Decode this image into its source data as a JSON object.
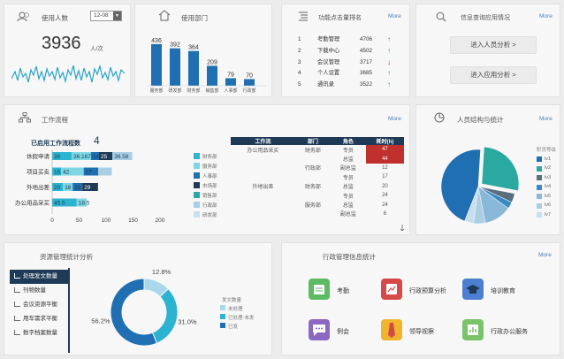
{
  "users": {
    "title": "使用人数",
    "date": "12-08",
    "count": "3936",
    "unit": "人/次"
  },
  "dept": {
    "title": "使用部门",
    "chart_data": {
      "type": "bar",
      "categories": [
        "服务部",
        "研发部",
        "财务部",
        "销售部",
        "人事部",
        "行政部"
      ],
      "values": [
        436,
        392,
        364,
        209,
        79,
        70
      ]
    }
  },
  "rank": {
    "title": "功能点击量排名",
    "more": "More",
    "rows": [
      {
        "no": "1",
        "name": "考勤管理",
        "val": "4706",
        "trend": "up"
      },
      {
        "no": "2",
        "name": "下载中心",
        "val": "4502",
        "trend": "up"
      },
      {
        "no": "3",
        "name": "会议管理",
        "val": "3717",
        "trend": "down"
      },
      {
        "no": "4",
        "name": "个人设置",
        "val": "3685",
        "trend": "up"
      },
      {
        "no": "5",
        "name": "通讯录",
        "val": "3522",
        "trend": "up"
      }
    ]
  },
  "query": {
    "title": "信息查询应用情况",
    "more": "More",
    "btn1": "进入人员分析 >",
    "btn2": "进入应用分析 >"
  },
  "workflow": {
    "title": "工作流程",
    "more": "More",
    "count_label": "已启用工作流程数",
    "count": "4",
    "chart_data": {
      "type": "bar",
      "categories": [
        "休假申请",
        "项目买卖",
        "外地出差",
        "办公用品采买"
      ],
      "series": [
        {
          "name": "财务部",
          "values": [
            36,
            16.5,
            20,
            45.5
          ]
        },
        {
          "name": "服务部",
          "values": [
            36.167,
            42,
            18,
            18.5
          ]
        },
        {
          "name": "人事部",
          "values": [
            14.667,
            27,
            18,
            0
          ]
        },
        {
          "name": "市场部",
          "values": [
            25,
            0,
            29,
            0
          ]
        },
        {
          "name": "销售部",
          "values": [
            0,
            0,
            0,
            0
          ]
        },
        {
          "name": "行政部",
          "values": [
            36.58,
            25,
            0,
            0
          ]
        },
        {
          "name": "研发部",
          "values": [
            0,
            0,
            0,
            0
          ]
        }
      ],
      "data_labels": [
        [
          "36",
          "36.167",
          "14.667",
          "25",
          "36.58",
          "25"
        ],
        [
          "16.5",
          "42",
          "27"
        ],
        [
          "20",
          "18",
          "18",
          "29"
        ],
        [
          "45.5",
          "18.5"
        ]
      ],
      "xticks": [
        "0",
        "50",
        "100",
        "150",
        "200"
      ]
    },
    "table": {
      "headers": [
        "工作流",
        "部门",
        "角色",
        "耗时(h)"
      ],
      "rows": [
        [
          "办公用品采买",
          "财务部",
          "专员",
          "47"
        ],
        [
          "",
          "",
          "总监",
          "44"
        ],
        [
          "",
          "行政部",
          "副总监",
          "12"
        ],
        [
          "",
          "",
          "专员",
          "17"
        ],
        [
          "外地出差",
          "财务部",
          "总监",
          "20"
        ],
        [
          "",
          "",
          "专员",
          "24"
        ],
        [
          "",
          "服务部",
          "总监",
          "24"
        ],
        [
          "",
          "",
          "副总监",
          "6"
        ]
      ]
    }
  },
  "personnel": {
    "title": "人员结构与统计",
    "more": "More",
    "legend_title": "职员等级",
    "legend": [
      "lv1",
      "lv2",
      "lv3",
      "lv4",
      "lv5",
      "lv6",
      "lv7"
    ],
    "colors": [
      "#1f6fb2",
      "#2aa9a0",
      "#5a6e80",
      "#3a88c8",
      "#8ab8d8",
      "#a8cfe3",
      "#c7dfee"
    ],
    "chart_data": {
      "type": "pie",
      "labels": [
        "lv1",
        "lv2",
        "lv3",
        "lv4",
        "lv5",
        "lv6",
        "lv7"
      ],
      "values": [
        45,
        27,
        4,
        3,
        12,
        5,
        4
      ]
    }
  },
  "resource": {
    "title": "资源管理统计分析",
    "side": [
      "处理发文数量",
      "刊物数量",
      "会议资源平衡",
      "用车需求平衡",
      "数字档案数量"
    ],
    "legend_title": "发文数量",
    "legend": [
      "未处理",
      "已处理·未发",
      "已发"
    ],
    "chart_data": {
      "type": "pie",
      "labels": [
        "未处理",
        "已处理·未发",
        "已发"
      ],
      "values": [
        12.8,
        31.0,
        56.2
      ],
      "value_labels": [
        "12.8%",
        "31.0%",
        "56.2%"
      ]
    }
  },
  "admin": {
    "title": "行政管理信息统计",
    "more": "More",
    "apps": [
      "考勤",
      "行政预算分析",
      "培训教育",
      "例会",
      "领导视察",
      "行政办公服务"
    ]
  }
}
